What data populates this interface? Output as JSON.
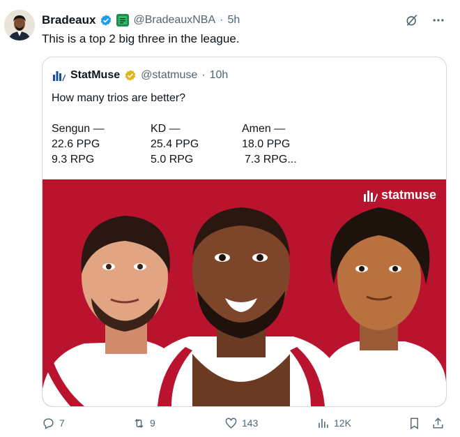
{
  "tweet": {
    "author_name": "Bradeaux",
    "author_handle": "@BradeauxNBA",
    "time": "5h",
    "separator": "·",
    "text": "This is a top 2 big three in the league."
  },
  "quote": {
    "author_name": "StatMuse",
    "author_handle": "@statmuse",
    "time": "10h",
    "separator": "·",
    "text": "How many trios are better?",
    "players": [
      {
        "name": "Sengun —",
        "ppg": "22.6 PPG",
        "rpg": "9.3 RPG"
      },
      {
        "name": "KD —",
        "ppg": "25.4 PPG",
        "rpg": "5.0 RPG"
      },
      {
        "name": "Amen —",
        "ppg": "18.0 PPG",
        "rpg": "7.3 RPG..."
      }
    ],
    "media_logo_text": "statmuse"
  },
  "actions": {
    "replies": "7",
    "retweets": "9",
    "likes": "143",
    "views": "12K"
  },
  "colors": {
    "accent": "#1d9bf0",
    "gold": "#e2b719",
    "media_bg": "#b9132e",
    "muted": "#536471"
  }
}
